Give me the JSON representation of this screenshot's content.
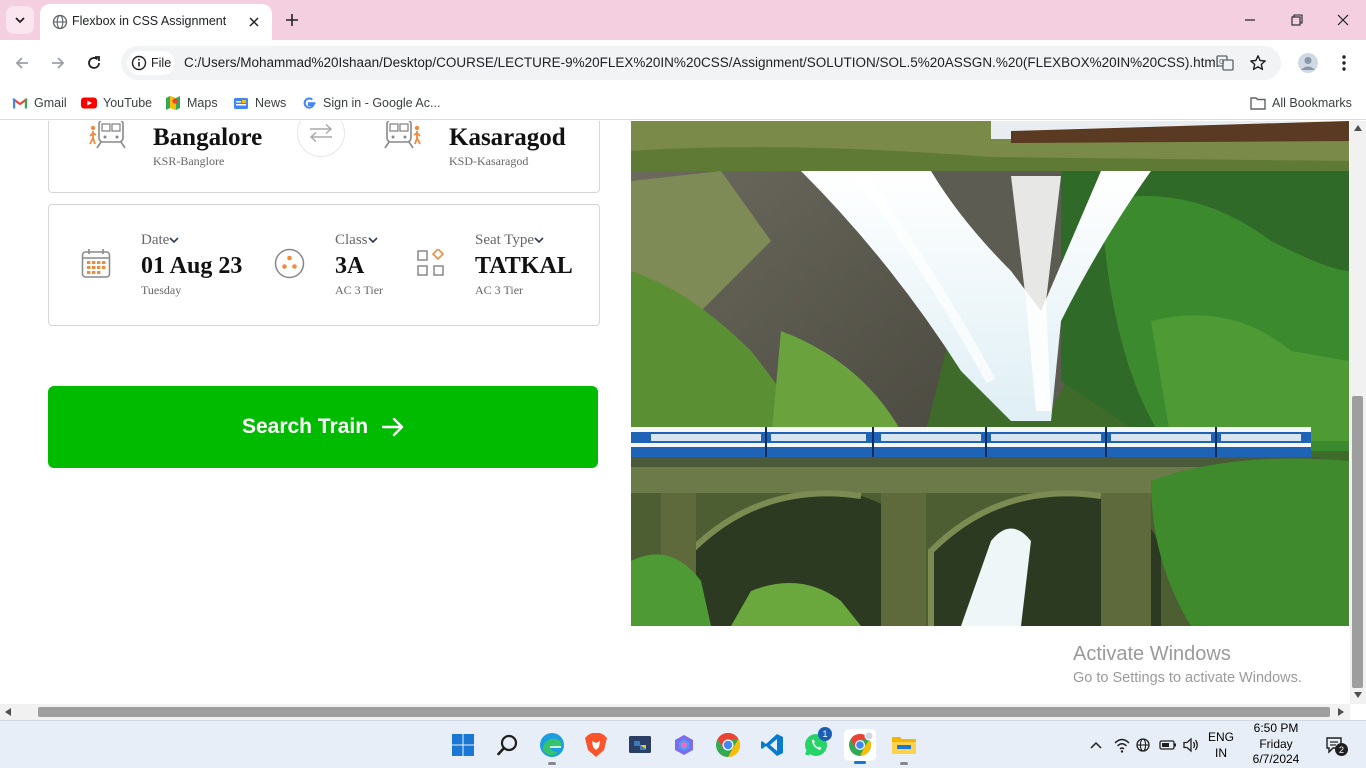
{
  "browser": {
    "tab": {
      "title": "Flexbox in CSS Assignment"
    },
    "toolbar": {
      "site_chip": "File",
      "url": "C:/Users/Mohammad%20Ishaan/Desktop/COURSE/LECTURE-9%20FLEX%20IN%20CSS/Assignment/SOLUTION/SOL.5%20ASSGN.%20(FLEXBOX%20IN%20CSS).html"
    },
    "bookmarks": [
      {
        "label": "Gmail",
        "icon": "gmail-icon"
      },
      {
        "label": "YouTube",
        "icon": "youtube-icon"
      },
      {
        "label": "Maps",
        "icon": "maps-icon"
      },
      {
        "label": "News",
        "icon": "news-icon"
      },
      {
        "label": "Sign in - Google Ac...",
        "icon": "google-icon"
      }
    ],
    "all_bookmarks": "All Bookmarks"
  },
  "page": {
    "from": {
      "city": "Bangalore",
      "code": "KSR-Banglore"
    },
    "to": {
      "city": "Kasaragod",
      "code": "KSD-Kasaragod"
    },
    "date": {
      "label": "Date",
      "value": "01 Aug 23",
      "sub": "Tuesday"
    },
    "class": {
      "label": "Class",
      "value": "3A",
      "sub": "AC 3 Tier"
    },
    "seat": {
      "label": "Seat Type",
      "value": "TATKAL",
      "sub": "AC 3 Tier"
    },
    "search_button": "Search Train",
    "colors": {
      "accent": "#00bb00",
      "icon_orange": "#f08a3c"
    }
  },
  "watermark": {
    "line1": "Activate Windows",
    "line2": "Go to Settings to activate Windows."
  },
  "taskbar": {
    "lang_line1": "ENG",
    "lang_line2": "IN",
    "time": "6:50 PM",
    "day": "Friday",
    "date": "6/7/2024",
    "whatsapp_badge": "1",
    "notification_count": "2"
  }
}
